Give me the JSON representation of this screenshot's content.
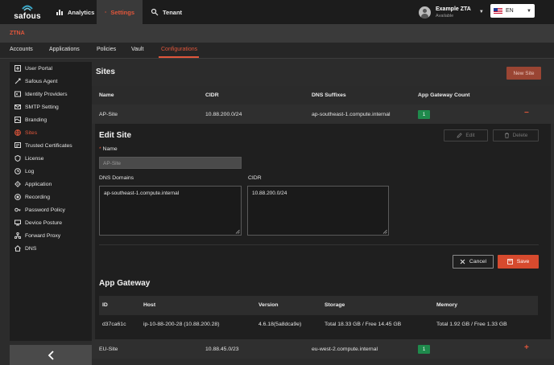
{
  "brand": {
    "name": "safous",
    "accent": "#e0563b"
  },
  "top_nav": {
    "tabs": [
      {
        "label": "Analytics",
        "icon": "bar-chart-icon"
      },
      {
        "label": "Settings",
        "icon": "gear-icon",
        "active": true
      },
      {
        "label": "Tenant",
        "icon": "tenant-icon"
      }
    ],
    "user": {
      "name": "Example ZTA",
      "status": "Available"
    },
    "language": {
      "selected": "EN",
      "flag": "us-flag-icon"
    }
  },
  "section": {
    "title": "ZTNA"
  },
  "sub_tabs": [
    {
      "label": "Accounts"
    },
    {
      "label": "Applications"
    },
    {
      "label": "Policies"
    },
    {
      "label": "Vault"
    },
    {
      "label": "Configurations",
      "active": true
    }
  ],
  "sidebar": {
    "items": [
      {
        "label": "User Portal",
        "icon": "portal-icon"
      },
      {
        "label": "Safous Agent",
        "icon": "agent-icon"
      },
      {
        "label": "Identity Providers",
        "icon": "identity-icon"
      },
      {
        "label": "SMTP Setting",
        "icon": "mail-icon"
      },
      {
        "label": "Branding",
        "icon": "branding-icon"
      },
      {
        "label": "Sites",
        "icon": "globe-icon",
        "active": true
      },
      {
        "label": "Trusted Certificates",
        "icon": "certificate-icon"
      },
      {
        "label": "License",
        "icon": "shield-icon"
      },
      {
        "label": "Log",
        "icon": "clock-icon"
      },
      {
        "label": "Application",
        "icon": "gear-icon"
      },
      {
        "label": "Recording",
        "icon": "record-icon"
      },
      {
        "label": "Password Policy",
        "icon": "key-icon"
      },
      {
        "label": "Device Posture",
        "icon": "device-icon"
      },
      {
        "label": "Forward Proxy",
        "icon": "proxy-icon"
      },
      {
        "label": "DNS",
        "icon": "home-icon"
      }
    ],
    "collapse_icon": "chevron-left-icon"
  },
  "sites": {
    "title": "Sites",
    "new_site_label": "New Site",
    "columns": [
      "Name",
      "CIDR",
      "DNS Suffixes",
      "App Gateway Count"
    ],
    "rows": [
      {
        "name": "AP-Site",
        "cidr": "10.88.200.0/24",
        "dns": "ap-southeast-1.compute.internal",
        "count": "1",
        "action": "−"
      },
      {
        "name": "EU-Site",
        "cidr": "10.88.45.0/23",
        "dns": "eu-west-2.compute.internal",
        "count": "1",
        "action": "+"
      }
    ]
  },
  "edit_site": {
    "title": "Edit Site",
    "edit_label": "Edit",
    "delete_label": "Delete",
    "name_label": "Name",
    "name_required_mark": "*",
    "name_placeholder": "AP-Site",
    "dns_label": "DNS Domains",
    "dns_value": "ap-southeast-1.compute.internal",
    "cidr_label": "CIDR",
    "cidr_value": "10.88.200.0/24",
    "cancel_label": "Cancel",
    "save_label": "Save"
  },
  "app_gateway": {
    "title": "App Gateway",
    "columns": [
      "ID",
      "Host",
      "Version",
      "Storage",
      "Memory"
    ],
    "rows": [
      {
        "id": "d37ca61c",
        "host": "ip-10-88-200-28 (10.88.200.28)",
        "version": "4.6.18(5a8dca9e)",
        "storage": "Total 18.33 GB / Free 14.45 GB",
        "memory": "Total 1.92 GB / Free 1.33 GB"
      }
    ]
  }
}
